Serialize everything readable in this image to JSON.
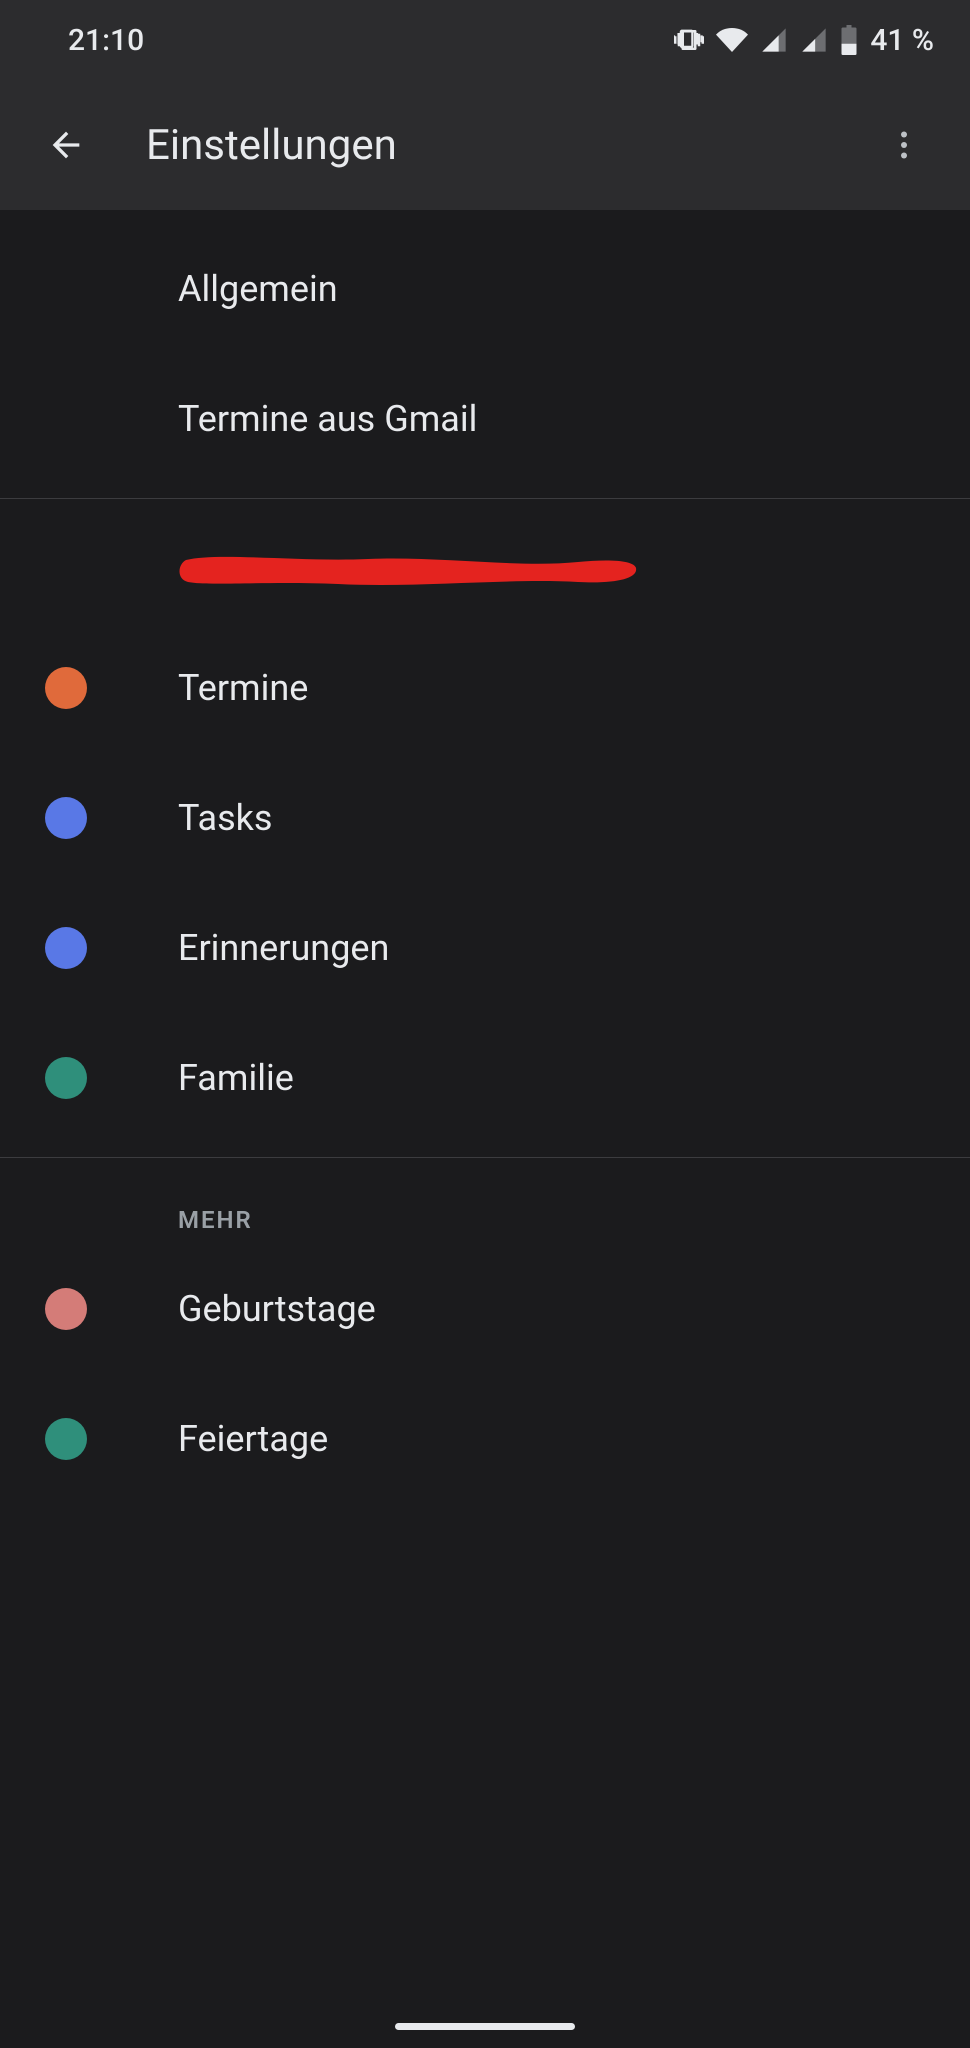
{
  "status": {
    "time": "21:10",
    "battery_text": "41 %"
  },
  "appbar": {
    "title": "Einstellungen"
  },
  "section_general": {
    "items": [
      {
        "label": "Allgemein"
      },
      {
        "label": "Termine aus Gmail"
      }
    ]
  },
  "section_account": {
    "calendars": [
      {
        "label": "Termine",
        "color": "#e06a3b"
      },
      {
        "label": "Tasks",
        "color": "#5978e6"
      },
      {
        "label": "Erinnerungen",
        "color": "#5978e6"
      },
      {
        "label": "Familie",
        "color": "#2f8f7b"
      }
    ]
  },
  "section_more": {
    "header": "MEHR",
    "items": [
      {
        "label": "Geburtstage",
        "color": "#d47c78"
      },
      {
        "label": "Feiertage",
        "color": "#2f8f7b"
      }
    ]
  },
  "colors": {
    "redaction": "#e4231f"
  }
}
